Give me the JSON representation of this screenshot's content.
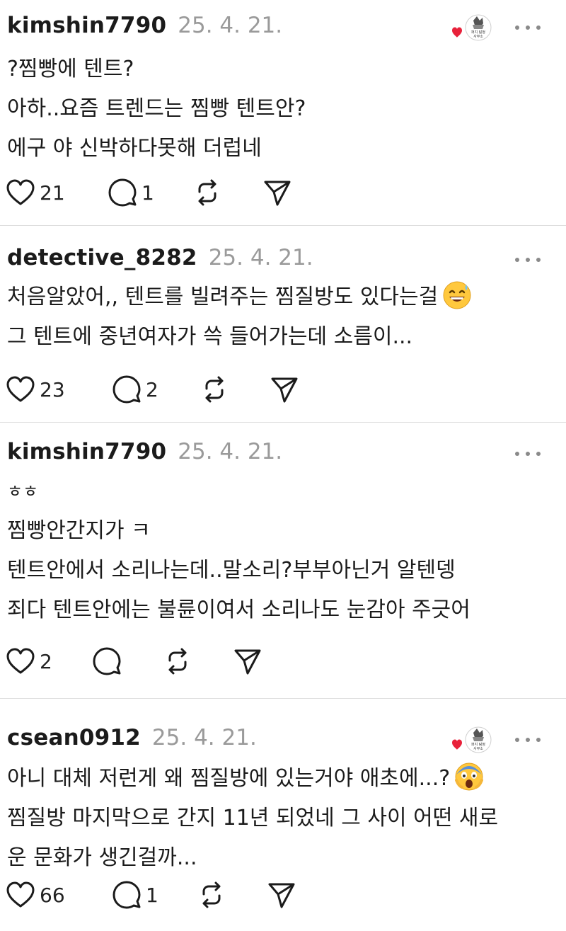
{
  "posts": [
    {
      "username": "kimshin7790",
      "timestamp": "25. 4. 21.",
      "lines": [
        "?찜빵에 텐트?",
        "아하..요즘 트렌드는 찜빵 텐트안?",
        "에구 야 신박하다못해 더럽네"
      ],
      "likes": "21",
      "replies": "1",
      "has_like_badge": true,
      "badge_text": "퍼지 탐정 사무소"
    },
    {
      "username": "detective_8282",
      "timestamp": "25. 4. 21.",
      "lines": [
        "처음알았어,, 텐트를 빌려주는 찜질방도 있다는걸",
        "그 텐트에 중년여자가 쓱 들어가는데 소름이..."
      ],
      "emoji_after_line_1": "sweat-smile-emoji",
      "likes": "23",
      "replies": "2"
    },
    {
      "username": "kimshin7790",
      "timestamp": "25. 4. 21.",
      "lines": [
        "ㅎㅎ",
        "찜빵안간지가 ㅋ",
        "텐트안에서 소리나는데..말소리?부부아닌거 알텐뎅",
        "죄다 텐트안에는 불륜이여서 소리나도 눈감아 주긋어"
      ],
      "likes": "2",
      "replies": ""
    },
    {
      "username": "csean0912",
      "timestamp": "25. 4. 21.",
      "lines": [
        "아니 대체 저런게 왜 찜질방에 있는거야 애초에...?",
        "찜질방 마지막으로 간지 11년 되었네 그 사이 어떤 새로",
        "운 문화가 생긴걸까..."
      ],
      "emoji_after_line_1": "screaming-face-emoji",
      "likes": "66",
      "replies": "1",
      "has_like_badge": true,
      "badge_text": "퍼지 탐정 사무소"
    }
  ],
  "colors": {
    "text": "#1b1b1b",
    "timestamp": "#9a9a9a",
    "heart_badge": "#e8213a",
    "divider": "#dedede"
  },
  "icons": {
    "like": "heart-icon",
    "reply": "comment-icon",
    "repost": "repost-icon",
    "share": "send-icon",
    "more": "more-icon"
  }
}
